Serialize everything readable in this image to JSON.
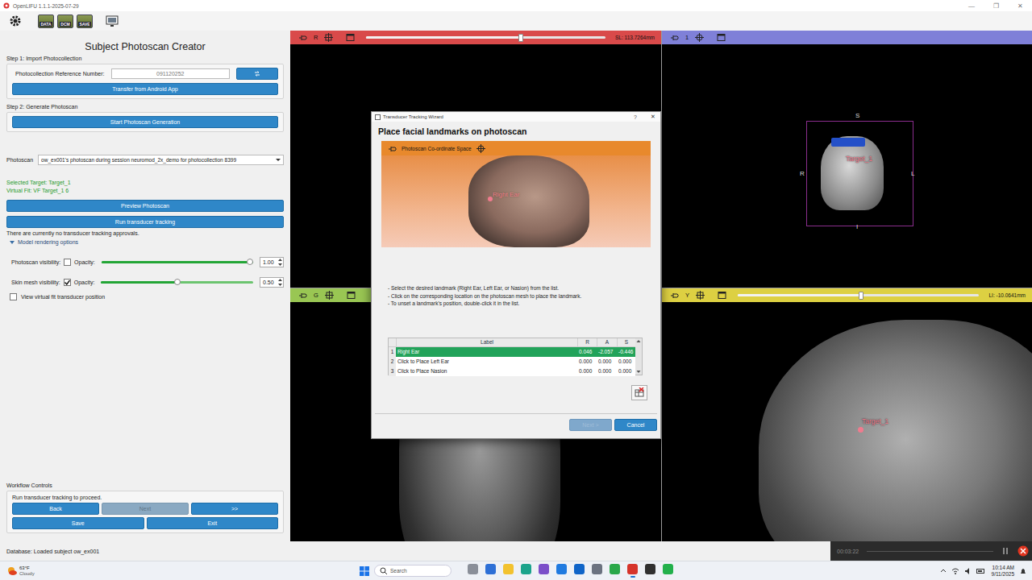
{
  "window": {
    "title": "OpenLIFU 1.1.1-2025-07-29",
    "controls": [
      "—",
      "❐",
      "✕"
    ]
  },
  "toolbar": [
    {
      "kind": "gear"
    },
    {
      "kind": "module",
      "label": "DATA"
    },
    {
      "kind": "module",
      "label": "DCM"
    },
    {
      "kind": "module",
      "label": "SAVE"
    },
    {
      "kind": "screen"
    }
  ],
  "panel": {
    "title": "Subject Photoscan Creator",
    "step1": {
      "label": "Step 1: Import Photocollection",
      "field_label": "Photocollection Reference Number:",
      "field_value": "091120252",
      "button": "Transfer from Android App"
    },
    "step2": {
      "label": "Step 2: Generate Photoscan",
      "button": "Start Photoscan Generation"
    },
    "photoscan": {
      "label": "Photoscan",
      "value": "ow_ex001's photoscan during session neuromod_2x_demo for photocollection 8399"
    },
    "info": [
      "Selected Target: Target_1",
      "Virtual Fit: VF Target_1 6"
    ],
    "buttons": [
      "Preview Photoscan",
      "Run transducer tracking"
    ],
    "approvals": "There are currently no transducer tracking approvals.",
    "rendering": {
      "label": "Model rendering options",
      "expanded": true,
      "rows": [
        {
          "label": "Photoscan visibility:",
          "checked": false,
          "opacity_label": "Opacity:",
          "level": 1.0,
          "value": "1.00"
        },
        {
          "label": "Skin mesh visibility:",
          "checked": true,
          "opacity_label": "Opacity:",
          "level": 0.5,
          "value": "0.50"
        }
      ]
    },
    "virtual_fit_checkbox": {
      "label": "View virtual fit transducer position",
      "checked": false
    }
  },
  "workflow": {
    "title": "Workflow Controls",
    "message": "Run transducer tracking to proceed.",
    "buttons": [
      {
        "label": "Back",
        "disabled": false
      },
      {
        "label": "Next",
        "disabled": true
      },
      {
        "label": ">>",
        "disabled": false
      },
      {
        "label": "Save",
        "disabled": false
      },
      {
        "label": "Exit",
        "disabled": false
      }
    ]
  },
  "status_bar": {
    "text": "Database: Loaded subject ow_ex001",
    "recorder_time": "00:03:22"
  },
  "views": [
    {
      "label": "R",
      "color": "#d94a4a",
      "kind": "empty",
      "slider": {
        "level": 0.65
      },
      "reading": "SL: 113.7264mm"
    },
    {
      "label": "1",
      "color": "#7f80d8",
      "kind": "render3d",
      "orientation": [
        "S",
        "R",
        "L",
        "I"
      ],
      "marker": "Target_1"
    },
    {
      "label": "G",
      "color": "#99c653",
      "kind": "coronal"
    },
    {
      "label": "Y",
      "color": "#ddd042",
      "kind": "sagittal",
      "slider": {
        "level": 0.51
      },
      "reading": "LI: -10.0641mm",
      "marker": "Target_1"
    }
  ],
  "dialog": {
    "title": "Transducer Tracking Wizard",
    "help": "?",
    "close": "✕",
    "heading": "Place facial landmarks on photoscan",
    "viewer": {
      "label": "Photoscan Co-ordinate Space",
      "marker": "Right Ear"
    },
    "instructions": [
      "- Select the desired landmark (Right Ear, Left Ear, or Nasion) from the list.",
      "- Click on the corresponding location on the photoscan mesh to place the landmark.",
      "- To unset a landmark's position, double-click it in the list."
    ],
    "table": {
      "columns": [
        "Label",
        "R",
        "A",
        "S"
      ],
      "rows": [
        {
          "index": "1",
          "cells": [
            "Right Ear",
            "0.046",
            "-2.057",
            "-0.446"
          ],
          "selected": true
        },
        {
          "index": "2",
          "cells": [
            "Click to Place Left Ear",
            "0.000",
            "0.000",
            "0.000"
          ],
          "selected": false
        },
        {
          "index": "3",
          "cells": [
            "Click to Place Nasion",
            "0.000",
            "0.000",
            "0.000"
          ],
          "selected": false
        }
      ]
    },
    "buttons": [
      {
        "label": "Next >",
        "disabled": true
      },
      {
        "label": "Cancel",
        "disabled": false
      }
    ]
  },
  "taskbar": {
    "weather": {
      "temp": "63°F",
      "condition": "Cloudy"
    },
    "search": {
      "placeholder": "Search"
    },
    "apps": [
      {
        "color": "#8a8f99",
        "active": false
      },
      {
        "color": "#2d6fd6",
        "active": false
      },
      {
        "color": "#f2c230",
        "active": false
      },
      {
        "color": "#1aa38c",
        "active": false
      },
      {
        "color": "#7b4fc9",
        "active": false
      },
      {
        "color": "#1f7ae0",
        "active": false
      },
      {
        "color": "#0f64c8",
        "active": false
      },
      {
        "color": "#6b7280",
        "active": false
      },
      {
        "color": "#2aa84a",
        "active": false
      },
      {
        "color": "#d6342b",
        "active": true
      },
      {
        "color": "#303030",
        "active": false
      },
      {
        "color": "#22b04b",
        "active": false
      }
    ],
    "time": "10:14 AM",
    "date": "9/11/2025"
  }
}
